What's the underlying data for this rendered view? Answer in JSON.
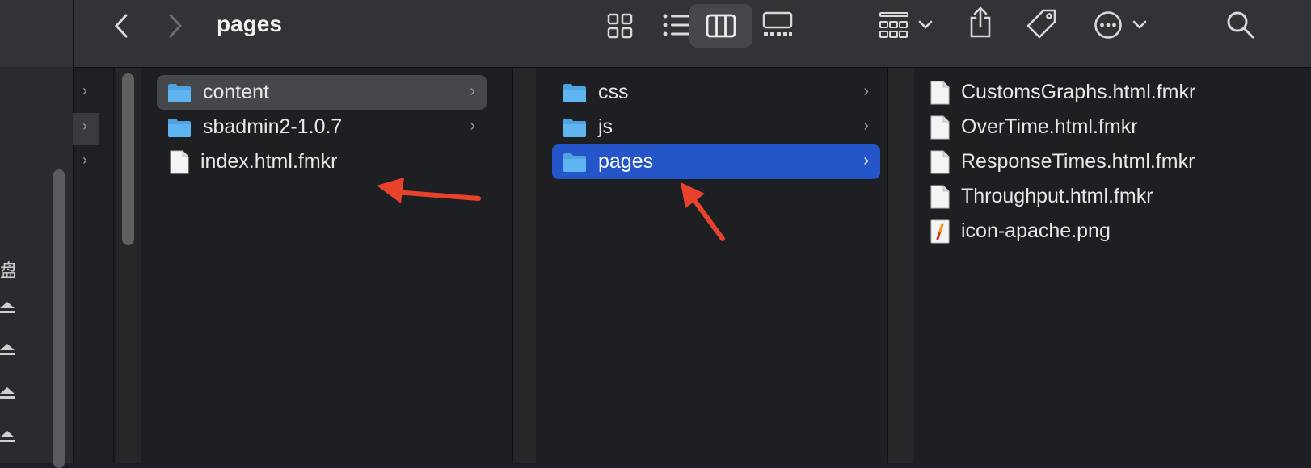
{
  "toolbar": {
    "title": "pages",
    "icons": [
      "back-chevron-icon",
      "forward-chevron-icon",
      "icon-view-icon",
      "list-view-icon",
      "column-view-icon",
      "gallery-view-icon",
      "group-icon",
      "share-icon",
      "tag-icon",
      "more-icon",
      "search-icon"
    ]
  },
  "sidebar": {
    "glyph": "盘"
  },
  "column1": {
    "items": [
      {
        "label": "content",
        "type": "folder",
        "selected": "gray",
        "has_children": true
      },
      {
        "label": "sbadmin2-1.0.7",
        "type": "folder",
        "has_children": true
      },
      {
        "label": "index.html.fmkr",
        "type": "file"
      }
    ]
  },
  "column2": {
    "items": [
      {
        "label": "css",
        "type": "folder",
        "has_children": true
      },
      {
        "label": "js",
        "type": "folder",
        "has_children": true
      },
      {
        "label": "pages",
        "type": "folder",
        "selected": "blue",
        "has_children": true
      }
    ]
  },
  "column3": {
    "items": [
      {
        "label": "CustomsGraphs.html.fmkr",
        "type": "file"
      },
      {
        "label": "OverTime.html.fmkr",
        "type": "file"
      },
      {
        "label": "ResponseTimes.html.fmkr",
        "type": "file"
      },
      {
        "label": "Throughput.html.fmkr",
        "type": "file"
      },
      {
        "label": "icon-apache.png",
        "type": "image"
      }
    ]
  },
  "annotation_color": "#e8412c"
}
